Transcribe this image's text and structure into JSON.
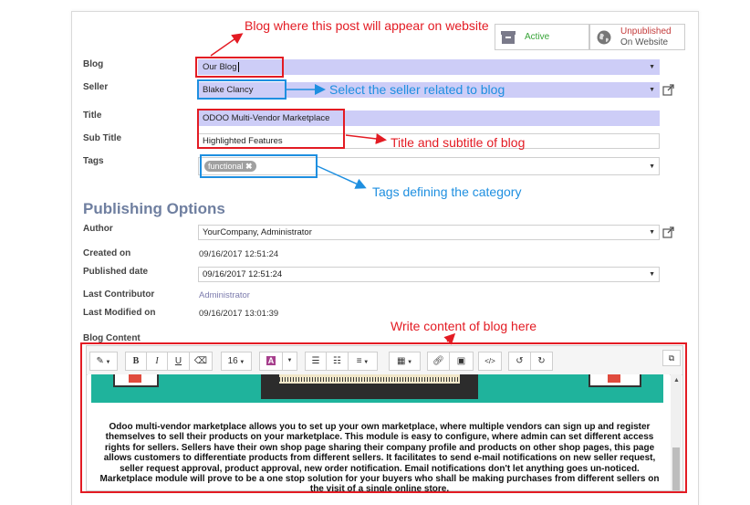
{
  "status": {
    "active_label": "Active",
    "unpublished_label": "Unpublished",
    "on_website_label": "On Website",
    "active_color": "#36a336",
    "unpublished_color": "#c43b3b"
  },
  "form": {
    "blog": {
      "label": "Blog",
      "value": "Our Blog"
    },
    "seller": {
      "label": "Seller",
      "value": "Blake Clancy"
    },
    "title": {
      "label": "Title",
      "value": "ODOO Multi-Vendor Marketplace"
    },
    "subtitle": {
      "label": "Sub Title",
      "value": "Highlighted Features"
    },
    "tags": {
      "label": "Tags",
      "chip": "functional"
    }
  },
  "publishing": {
    "heading": "Publishing Options",
    "author": {
      "label": "Author",
      "value": "YourCompany, Administrator"
    },
    "created_on": {
      "label": "Created on",
      "value": "09/16/2017 12:51:24"
    },
    "published_date": {
      "label": "Published date",
      "value": "09/16/2017 12:51:24"
    },
    "last_contributor": {
      "label": "Last Contributor",
      "value": "Administrator"
    },
    "last_modified": {
      "label": "Last Modified on",
      "value": "09/16/2017 13:01:39"
    }
  },
  "content": {
    "label": "Blog Content",
    "toolbar": {
      "bold": "B",
      "italic": "I",
      "underline": "U",
      "font_size": "16",
      "text_color": "A",
      "code_view": "</>"
    },
    "body": "Odoo multi-vendor marketplace allows you to set up your own marketplace, where multiple vendors can sign up and register themselves to sell their products on your marketplace. This module is easy to configure, where admin can set different access rights for sellers. Sellers have their own shop page sharing their company profile and products on other shop pages, this page allows customers to differentiate products from different sellers. It facilitates to send e-mail notifications on new seller request, seller request approval, product approval, new order notification. Email notifications don't let anything goes un-noticed. Marketplace module will prove to be a one stop solution for your buyers who shall be making purchases from different sellers on the visit of a single online store."
  },
  "annotations": {
    "blog": "Blog where this post will appear on website",
    "seller": "Select the seller related to blog",
    "title": "Title and subtitle of blog",
    "tags": "Tags defining the category",
    "content": "Write content of blog here"
  },
  "colors": {
    "annotation_red": "#e31b23",
    "annotation_blue": "#1e8fe0",
    "required_field": "#cdcdf7",
    "heading": "#6f7fa0",
    "banner": "#1fb39c"
  }
}
